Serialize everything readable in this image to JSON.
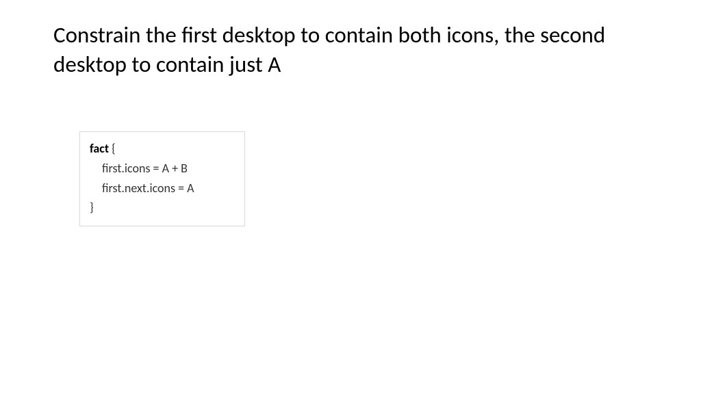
{
  "title": "Constrain the first desktop to contain both icons, the second desktop to contain just A",
  "code": {
    "line1_kw": "fact",
    "line1_rest": " {",
    "line2": "first.icons = A + B",
    "line3": "first.next.icons = A",
    "line4": "}"
  }
}
